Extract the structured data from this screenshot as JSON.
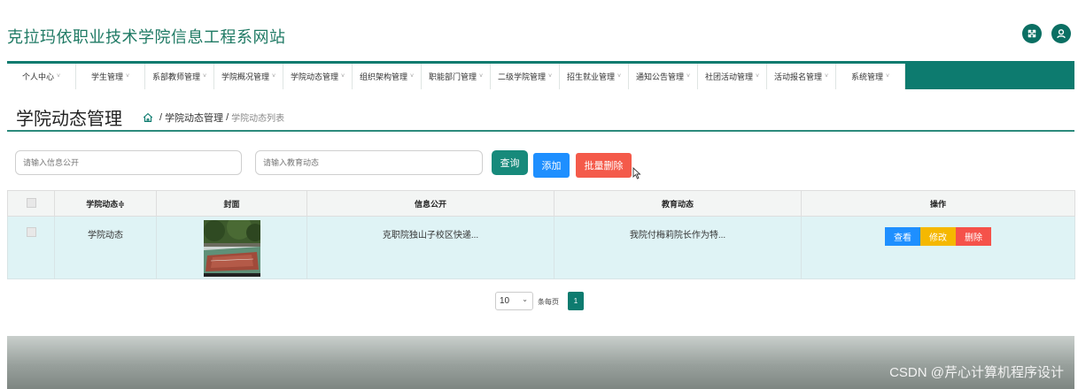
{
  "header": {
    "site_title": "克拉玛依职业技术学院信息工程系网站",
    "icons": [
      "fullscreen-icon",
      "user-icon"
    ]
  },
  "nav": [
    {
      "label": "个人中心",
      "w": 78
    },
    {
      "label": "学生管理",
      "w": 78
    },
    {
      "label": "系部教师管理",
      "w": 78
    },
    {
      "label": "学院概况管理",
      "w": 78
    },
    {
      "label": "学院动态管理",
      "w": 78
    },
    {
      "label": "组织架构管理",
      "w": 78
    },
    {
      "label": "职能部门管理",
      "w": 78
    },
    {
      "label": "二级学院管理",
      "w": 78
    },
    {
      "label": "招生就业管理",
      "w": 78
    },
    {
      "label": "通知公告管理",
      "w": 78
    },
    {
      "label": "社团活动管理",
      "w": 78
    },
    {
      "label": "活动报名管理",
      "w": 78
    },
    {
      "label": "系统管理",
      "w": 78
    }
  ],
  "page": {
    "title": "学院动态管理",
    "breadcrumb": {
      "level1": "学院动态管理",
      "level2": "学院动态列表",
      "sep": "/"
    }
  },
  "search": {
    "placeholder_1": "请输入信息公开",
    "placeholder_2": "请输入教育动态"
  },
  "buttons": {
    "query": "查询",
    "add": "添加",
    "batch_delete": "批量删除"
  },
  "table": {
    "headers": [
      "",
      "学院动态",
      "封面",
      "信息公开",
      "教育动态",
      "操作"
    ],
    "sort_indicator": "≑",
    "rows": [
      {
        "category": "学院动态",
        "info": "克职院独山子校区快递...",
        "news": "我院付梅莉院长作为特..."
      }
    ],
    "row_actions": {
      "view": "查看",
      "edit": "修改",
      "delete": "删除"
    }
  },
  "pagination": {
    "page_size": "10",
    "per_page_label": "条每页",
    "current_page": "1"
  },
  "watermark": "CSDN @芹心计算机程序设计",
  "colors": {
    "primary": "#0d7b6f",
    "query_btn": "#178a7b",
    "add_btn": "#1e8fff",
    "delete_btn": "#f45a4a",
    "view_btn": "#1e8fff",
    "edit_btn": "#f5b800",
    "del_btn": "#f5524a",
    "row_bg": "#dff3f5"
  }
}
